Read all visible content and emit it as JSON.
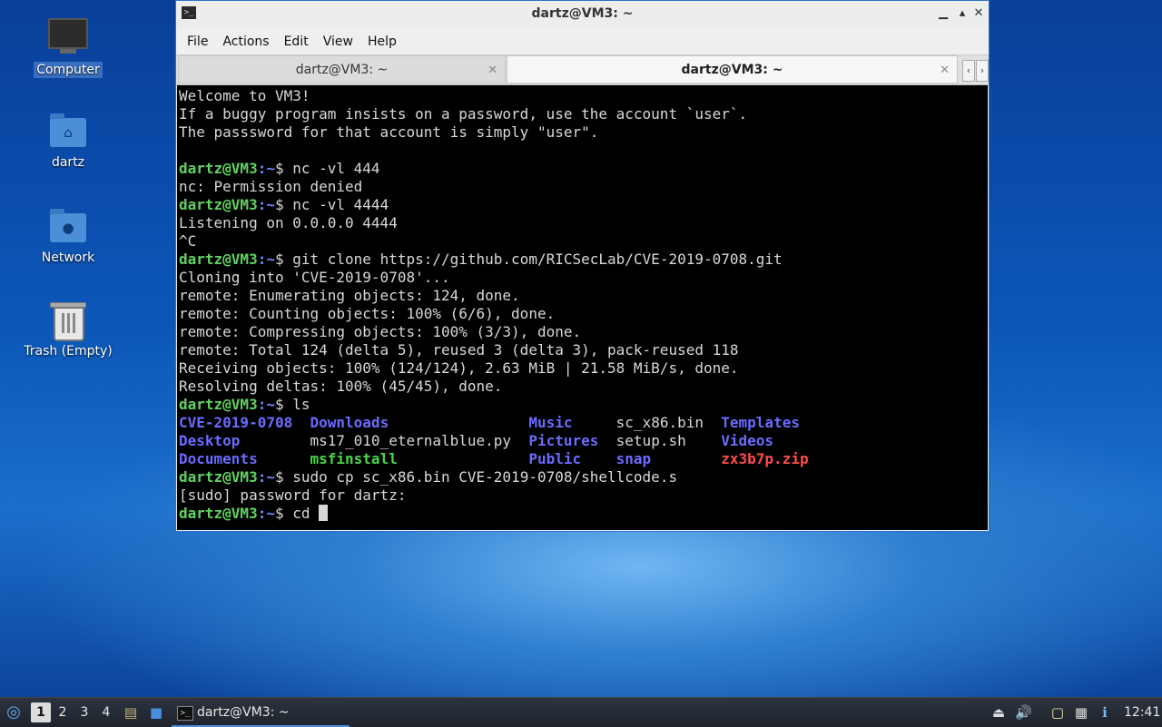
{
  "desktop": {
    "icons": [
      {
        "label": "Computer",
        "icon": "computer-icon"
      },
      {
        "label": "dartz",
        "icon": "home-folder-icon"
      },
      {
        "label": "Network",
        "icon": "network-folder-icon"
      },
      {
        "label": "Trash (Empty)",
        "icon": "trash-icon"
      }
    ]
  },
  "window": {
    "title": "dartz@VM3: ~",
    "controls": {
      "minimize": "▁",
      "maximize": "▴",
      "close": "✕"
    },
    "menu": [
      "File",
      "Actions",
      "Edit",
      "View",
      "Help"
    ],
    "tabs": [
      {
        "label": "dartz@VM3: ~",
        "active": false
      },
      {
        "label": "dartz@VM3: ~",
        "active": true
      }
    ],
    "tab_scroll": {
      "left": "‹",
      "right": "›"
    }
  },
  "terminal": {
    "prompt_user": "dartz@VM3",
    "prompt_path": ":~",
    "prompt_sym": "$ ",
    "lines": {
      "l1": "Welcome to VM3!",
      "l2": "If a buggy program insists on a password, use the account `user`.",
      "l3": "The passsword for that account is simply \"user\".",
      "cmd1": "nc -vl 444",
      "o1": "nc: Permission denied",
      "cmd2": "nc -vl 4444",
      "o2": "Listening on 0.0.0.0 4444",
      "o3": "^C",
      "cmd3": "git clone https://github.com/RICSecLab/CVE-2019-0708.git",
      "o4": "Cloning into 'CVE-2019-0708'...",
      "o5": "remote: Enumerating objects: 124, done.",
      "o6": "remote: Counting objects: 100% (6/6), done.",
      "o7": "remote: Compressing objects: 100% (3/3), done.",
      "o8": "remote: Total 124 (delta 5), reused 3 (delta 3), pack-reused 118",
      "o9": "Receiving objects: 100% (124/124), 2.63 MiB | 21.58 MiB/s, done.",
      "o10": "Resolving deltas: 100% (45/45), done.",
      "cmd4": "ls",
      "cmd5": "sudo cp sc_x86.bin CVE-2019-0708/shellcode.s",
      "o11": "[sudo] password for dartz:",
      "cmd6": "cd "
    },
    "ls": {
      "r1": [
        "CVE-2019-0708",
        "Downloads",
        "Music",
        "sc_x86.bin",
        "Templates"
      ],
      "r2": [
        "Desktop",
        "ms17_010_eternalblue.py",
        "Pictures",
        "setup.sh",
        "Videos"
      ],
      "r3": [
        "Documents",
        "msfinstall",
        "Public",
        "snap",
        "zx3b7p.zip"
      ]
    }
  },
  "taskbar": {
    "workspaces": [
      "1",
      "2",
      "3",
      "4"
    ],
    "active_workspace": "1",
    "task_label": "dartz@VM3: ~",
    "clock": "12:41"
  },
  "colors": {
    "prompt_user": "#5fd35f",
    "prompt_path": "#6b8cff",
    "directory": "#6b6bff",
    "executable": "#46d846",
    "archive": "#ff4b4b"
  }
}
